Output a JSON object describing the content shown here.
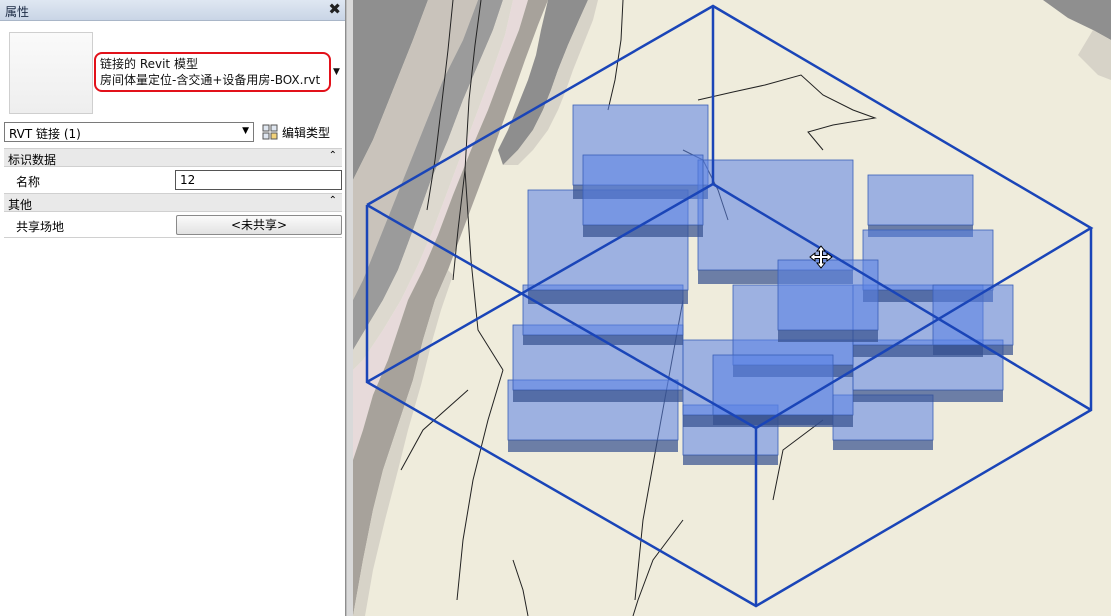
{
  "properties_panel": {
    "title": "属性",
    "close_symbol": "✖",
    "type_selector": {
      "family": "链接的 Revit 模型",
      "type": "房间体量定位-含交通+设备用房-BOX.rvt"
    },
    "instance_filter": "RVT 链接 (1)",
    "edit_type_label": "编辑类型",
    "groups": [
      {
        "label": "标识数据",
        "collapse_symbol": "⌃",
        "rows": [
          {
            "name": "名称",
            "value": "12"
          }
        ]
      },
      {
        "label": "其他",
        "collapse_symbol": "⌃",
        "rows": [
          {
            "name": "共享场地",
            "value": "<未共享>"
          }
        ]
      }
    ]
  },
  "colors": {
    "highlight": "#e2111a",
    "box_blue": "#1a45b8",
    "mass_fill": "#5a82e6",
    "background": "#efecdc"
  }
}
